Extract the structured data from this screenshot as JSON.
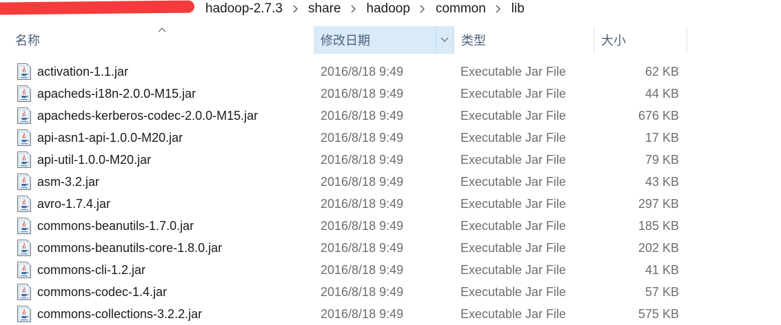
{
  "breadcrumb": [
    "hadoop-2.7.3",
    "share",
    "hadoop",
    "common",
    "lib"
  ],
  "columns": {
    "name": "名称",
    "date": "修改日期",
    "type": "类型",
    "size": "大小"
  },
  "sort": {
    "column": "name",
    "direction": "ascending",
    "highlighted_column": "date"
  },
  "colors": {
    "header_text": "#4c607a",
    "highlight_header": "#d9ebf9",
    "redaction": "#f53b3b"
  },
  "files": [
    {
      "name": "activation-1.1.jar",
      "date": "2016/8/18 9:49",
      "type": "Executable Jar File",
      "size": "62 KB"
    },
    {
      "name": "apacheds-i18n-2.0.0-M15.jar",
      "date": "2016/8/18 9:49",
      "type": "Executable Jar File",
      "size": "44 KB"
    },
    {
      "name": "apacheds-kerberos-codec-2.0.0-M15.jar",
      "date": "2016/8/18 9:49",
      "type": "Executable Jar File",
      "size": "676 KB"
    },
    {
      "name": "api-asn1-api-1.0.0-M20.jar",
      "date": "2016/8/18 9:49",
      "type": "Executable Jar File",
      "size": "17 KB"
    },
    {
      "name": "api-util-1.0.0-M20.jar",
      "date": "2016/8/18 9:49",
      "type": "Executable Jar File",
      "size": "79 KB"
    },
    {
      "name": "asm-3.2.jar",
      "date": "2016/8/18 9:49",
      "type": "Executable Jar File",
      "size": "43 KB"
    },
    {
      "name": "avro-1.7.4.jar",
      "date": "2016/8/18 9:49",
      "type": "Executable Jar File",
      "size": "297 KB"
    },
    {
      "name": "commons-beanutils-1.7.0.jar",
      "date": "2016/8/18 9:49",
      "type": "Executable Jar File",
      "size": "185 KB"
    },
    {
      "name": "commons-beanutils-core-1.8.0.jar",
      "date": "2016/8/18 9:49",
      "type": "Executable Jar File",
      "size": "202 KB"
    },
    {
      "name": "commons-cli-1.2.jar",
      "date": "2016/8/18 9:49",
      "type": "Executable Jar File",
      "size": "41 KB"
    },
    {
      "name": "commons-codec-1.4.jar",
      "date": "2016/8/18 9:49",
      "type": "Executable Jar File",
      "size": "57 KB"
    },
    {
      "name": "commons-collections-3.2.2.jar",
      "date": "2016/8/18 9:49",
      "type": "Executable Jar File",
      "size": "575 KB"
    }
  ]
}
